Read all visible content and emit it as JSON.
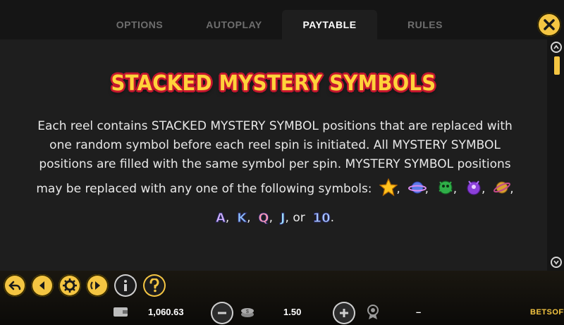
{
  "tabs": [
    {
      "label": "OPTIONS",
      "active": false
    },
    {
      "label": "AUTOPLAY",
      "active": false
    },
    {
      "label": "PAYTABLE",
      "active": true
    },
    {
      "label": "RULES",
      "active": false
    }
  ],
  "content": {
    "title": "STACKED MYSTERY SYMBOLS",
    "line1": "Each reel contains STACKED MYSTERY SYMBOL positions that are replaced with",
    "line2": "one random symbol before each reel spin is initiated. All MYSTERY SYMBOL",
    "line3": "positions are filled with the same symbol per spin. MYSTERY SYMBOL positions",
    "line4": "may be replaced with any one of the following symbols:",
    "symbol_icons": [
      "star-symbol-icon",
      "planet-symbol-icon",
      "green-alien-symbol-icon",
      "purple-alien-symbol-icon",
      "golden-planet-symbol-icon"
    ],
    "letters": [
      "A",
      "K",
      "Q",
      "J"
    ],
    "last_letter": "10",
    "separator": ",",
    "or_word": "or",
    "period": "."
  },
  "footer": {
    "balance": "1,060.63",
    "bet": "1.50",
    "win": "–",
    "brand": "BETSOFT"
  },
  "colors": {
    "accent": "#f4c542",
    "title_fill": "#ffd23a",
    "title_outline": "#c4162e",
    "panel_bg": "#1e1e1e"
  }
}
